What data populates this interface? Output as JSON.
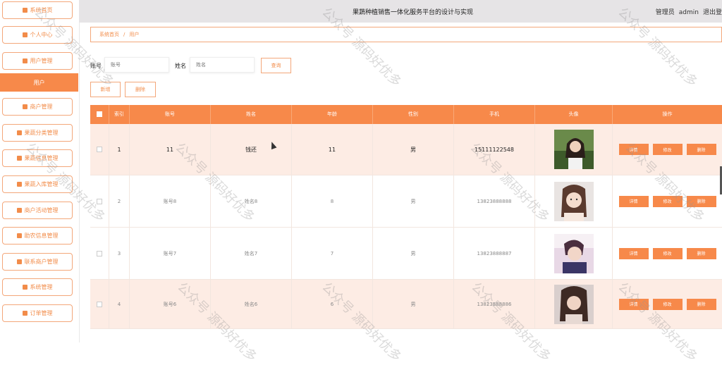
{
  "header": {
    "title": "果蔬种植销售一体化服务平台的设计与实现",
    "role": "管理员",
    "username": "admin",
    "logout": "退出登"
  },
  "sidebar": {
    "items": [
      {
        "label": "系统首页"
      },
      {
        "label": "个人中心"
      },
      {
        "label": "用户管理"
      },
      {
        "label": "用户",
        "active": true
      },
      {
        "label": "商户管理"
      },
      {
        "label": "果蔬分类管理"
      },
      {
        "label": "果蔬信息管理"
      },
      {
        "label": "果蔬入库管理"
      },
      {
        "label": "商户活动管理"
      },
      {
        "label": "助农信息管理"
      },
      {
        "label": "联系商户管理"
      },
      {
        "label": "系统管理"
      },
      {
        "label": "订单管理"
      }
    ]
  },
  "breadcrumb": {
    "home": "系统首页",
    "sep": "/",
    "current": "用户"
  },
  "search": {
    "account_label": "账号",
    "account_placeholder": "账号",
    "name_label": "姓名",
    "name_placeholder": "姓名",
    "query_button": "查询"
  },
  "actions": {
    "add": "新增",
    "delete": "删除"
  },
  "table": {
    "columns": [
      "索引",
      "账号",
      "姓名",
      "年龄",
      "性别",
      "手机",
      "头像",
      "操作"
    ],
    "rows": [
      {
        "index": "1",
        "account": "11",
        "name": "钱还",
        "age": "11",
        "gender": "男",
        "phone": "15111122548"
      },
      {
        "index": "2",
        "account": "账号8",
        "name": "姓名8",
        "age": "8",
        "gender": "男",
        "phone": "13823888888"
      },
      {
        "index": "3",
        "account": "账号7",
        "name": "姓名7",
        "age": "7",
        "gender": "男",
        "phone": "13823888887"
      },
      {
        "index": "4",
        "account": "账号6",
        "name": "姓名6",
        "age": "6",
        "gender": "男",
        "phone": "13823888886"
      }
    ],
    "row_actions": {
      "detail": "详情",
      "edit": "修改",
      "delete": "删除"
    }
  },
  "watermark": "公众号 源码好优多",
  "colors": {
    "accent": "#f7894a",
    "accent_light": "#fdece4",
    "header_bg": "#e6e4e6"
  }
}
